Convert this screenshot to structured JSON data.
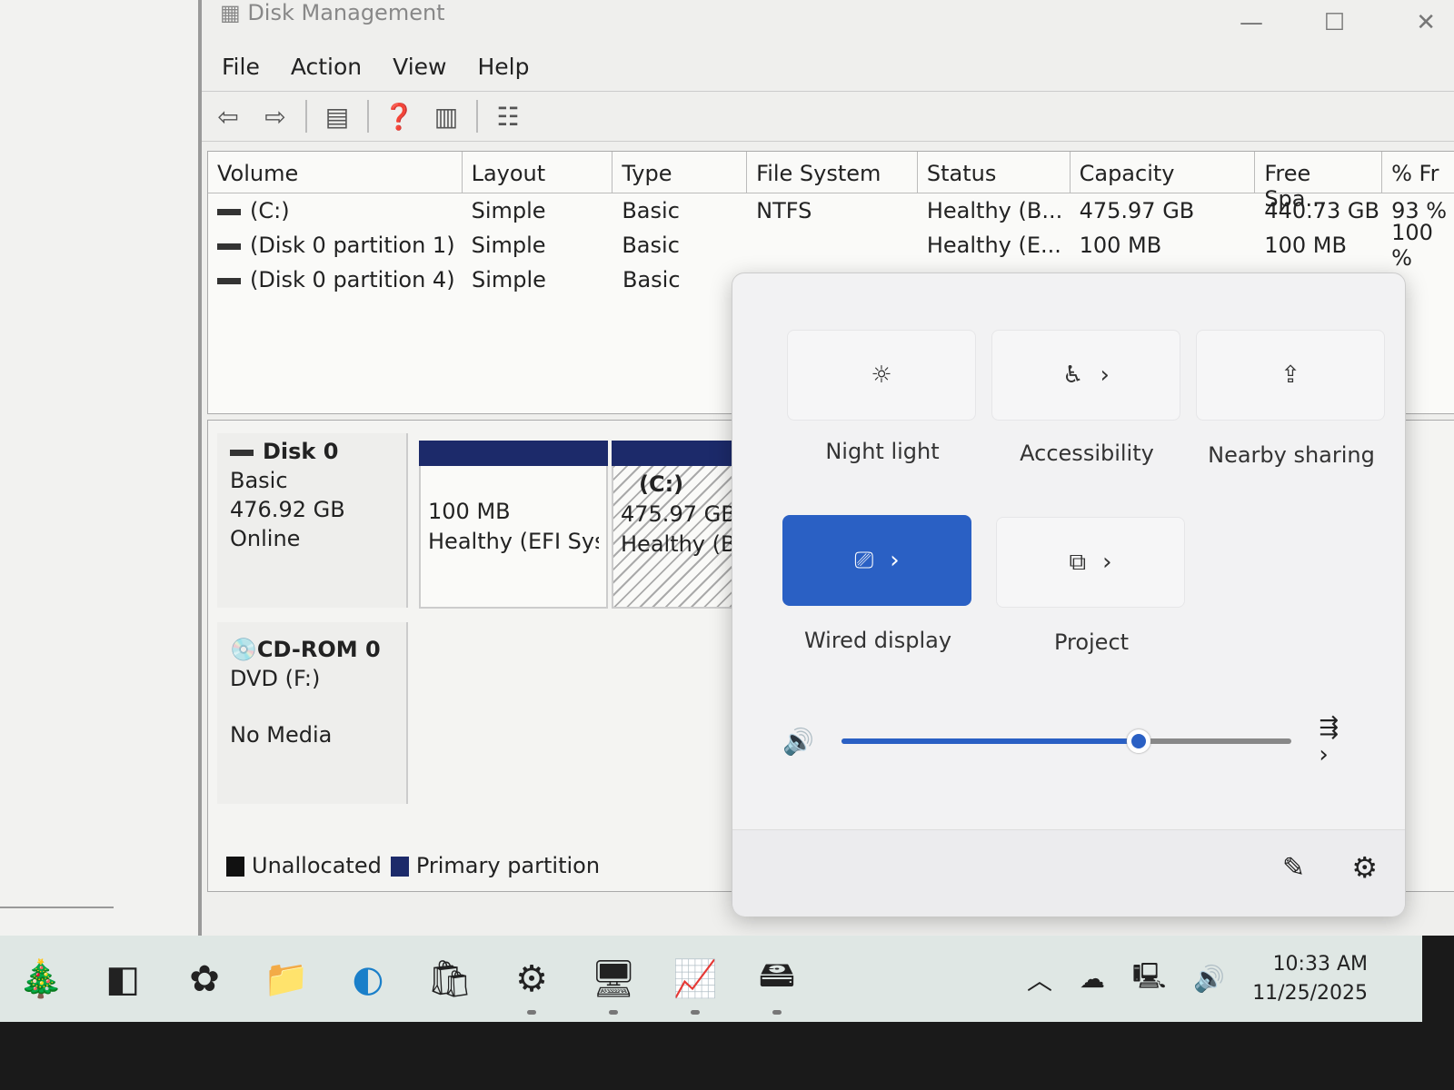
{
  "window": {
    "title": "Disk Management",
    "minimize": "—",
    "maximize": "☐",
    "close": "✕"
  },
  "menu": [
    "File",
    "Action",
    "View",
    "Help"
  ],
  "table": {
    "headers": [
      "Volume",
      "Layout",
      "Type",
      "File System",
      "Status",
      "Capacity",
      "Free Spa...",
      "% Fr"
    ],
    "rows": [
      [
        "(C:)",
        "Simple",
        "Basic",
        "NTFS",
        "Healthy (B...",
        "475.97 GB",
        "440.73 GB",
        "93 %"
      ],
      [
        "(Disk 0 partition 1)",
        "Simple",
        "Basic",
        "",
        "Healthy (E...",
        "100 MB",
        "100 MB",
        "100 %"
      ],
      [
        "(Disk 0 partition 4)",
        "Simple",
        "Basic",
        "",
        "",
        "",
        "",
        ""
      ]
    ]
  },
  "disks": [
    {
      "name": "Disk 0",
      "type": "Basic",
      "size": "476.92 GB",
      "state": "Online",
      "partitions": [
        {
          "label": "",
          "size": "100 MB",
          "status": "Healthy (EFI Sys"
        },
        {
          "label": "(C:)",
          "size": "475.97 GB",
          "status": "Healthy (B"
        }
      ]
    },
    {
      "name": "CD-ROM 0",
      "type": "DVD (F:)",
      "state": "No Media"
    }
  ],
  "legend": [
    {
      "label": "Unallocated",
      "color": "#111111"
    },
    {
      "label": "Primary partition",
      "color": "#1c2a6a"
    }
  ],
  "quick_settings": {
    "tiles": [
      {
        "label": "Night light",
        "icon": "brightness-icon"
      },
      {
        "label": "Accessibility",
        "icon": "accessibility-icon"
      },
      {
        "label": "Nearby sharing",
        "icon": "share-icon"
      },
      {
        "label": "Wired display",
        "icon": "cast-icon",
        "active": true
      },
      {
        "label": "Project",
        "icon": "project-icon"
      }
    ],
    "volume_percent": 66,
    "accent": "#2a60c4"
  },
  "taskbar": {
    "time": "10:33 AM",
    "date": "11/25/2025"
  }
}
